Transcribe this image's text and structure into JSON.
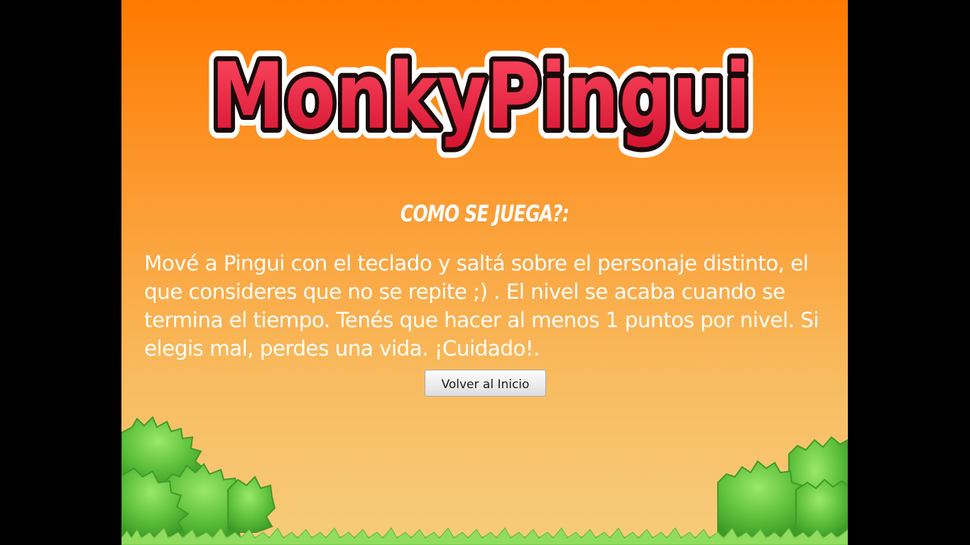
{
  "game": {
    "logo_text": "MonkyPingui",
    "heading": "Como se juega?:",
    "instructions": "Mové a Pingui con el teclado y saltá sobre el personaje distinto, el que consideres que no se repite ;) .  El nivel se acaba cuando se termina el tiempo. Tenés que hacer al menos 1 puntos por nivel. Si elegis mal, perdes una vida. ¡Cuidado!.",
    "back_button_label": "Volver al Inicio"
  },
  "colors": {
    "background_top": "#ff7a00",
    "background_bottom": "#f7cc7c",
    "logo_fill": "#e8253f",
    "logo_outline": "#1a0a0a",
    "logo_halo": "#ffffff",
    "text": "#ffffff",
    "bush_green": "#5cbf3a",
    "grass_green": "#7fd454"
  },
  "icons": {
    "logo": "monkypingui-wordmark",
    "scenery": "green-bushes"
  }
}
